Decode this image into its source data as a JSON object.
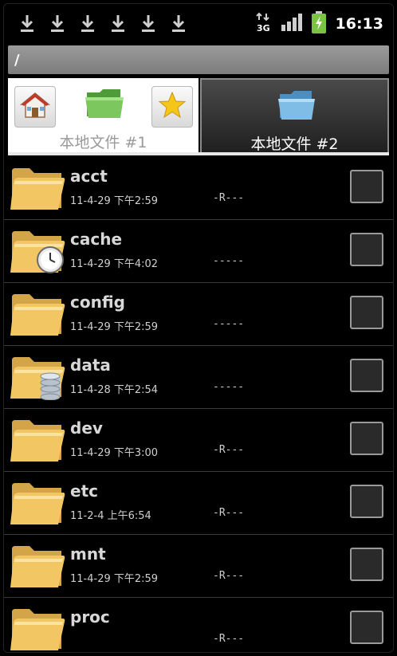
{
  "status_bar": {
    "download_icons": [
      "download-icon",
      "download-icon",
      "download-icon",
      "download-icon",
      "download-icon",
      "download-icon"
    ],
    "network": "3G",
    "time": "16:13"
  },
  "path": "/",
  "tabs": [
    {
      "label": "本地文件 #1",
      "active": false
    },
    {
      "label": "本地文件 #2",
      "active": true
    }
  ],
  "files": [
    {
      "name": "acct",
      "date": "11-4-29 下午2:59",
      "perm": "-R---",
      "badge": ""
    },
    {
      "name": "cache",
      "date": "11-4-29 下午4:02",
      "perm": "-----",
      "badge": "clock"
    },
    {
      "name": "config",
      "date": "11-4-29 下午2:59",
      "perm": "-----",
      "badge": ""
    },
    {
      "name": "data",
      "date": "11-4-28 下午2:54",
      "perm": "-----",
      "badge": "database"
    },
    {
      "name": "dev",
      "date": "11-4-29 下午3:00",
      "perm": "-R---",
      "badge": ""
    },
    {
      "name": "etc",
      "date": "11-2-4 上午6:54",
      "perm": "-R---",
      "badge": ""
    },
    {
      "name": "mnt",
      "date": "11-4-29 下午2:59",
      "perm": "-R---",
      "badge": ""
    },
    {
      "name": "proc",
      "date": "",
      "perm": "-R---",
      "badge": ""
    }
  ],
  "colors": {
    "folder": "#f2c663",
    "path_bar": "#8a8a8a",
    "battery": "#7bc342"
  }
}
